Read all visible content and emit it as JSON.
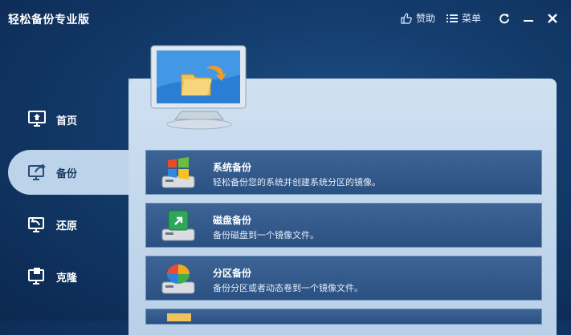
{
  "app": {
    "title": "轻松备份专业版"
  },
  "toolbar": {
    "donate_label": "赞助",
    "menu_label": "菜单"
  },
  "sidebar": {
    "items": [
      {
        "label": "首页",
        "icon": "home-monitor-icon",
        "active": false
      },
      {
        "label": "备份",
        "icon": "backup-monitor-icon",
        "active": true
      },
      {
        "label": "还原",
        "icon": "restore-monitor-icon",
        "active": false
      },
      {
        "label": "克隆",
        "icon": "clone-monitor-icon",
        "active": false
      }
    ]
  },
  "operations": [
    {
      "title": "系统备份",
      "desc": "轻松备份您的系统并创建系统分区的镜像。",
      "icon": "windows-system-icon"
    },
    {
      "title": "磁盘备份",
      "desc": "备份磁盘到一个镜像文件。",
      "icon": "disk-icon"
    },
    {
      "title": "分区备份",
      "desc": "备份分区或者动态卷到一个镜像文件。",
      "icon": "partition-pie-icon"
    }
  ],
  "colors": {
    "accent_bg": "#133b6b",
    "panel": "#bcd3ea",
    "card": "#2f5686"
  }
}
